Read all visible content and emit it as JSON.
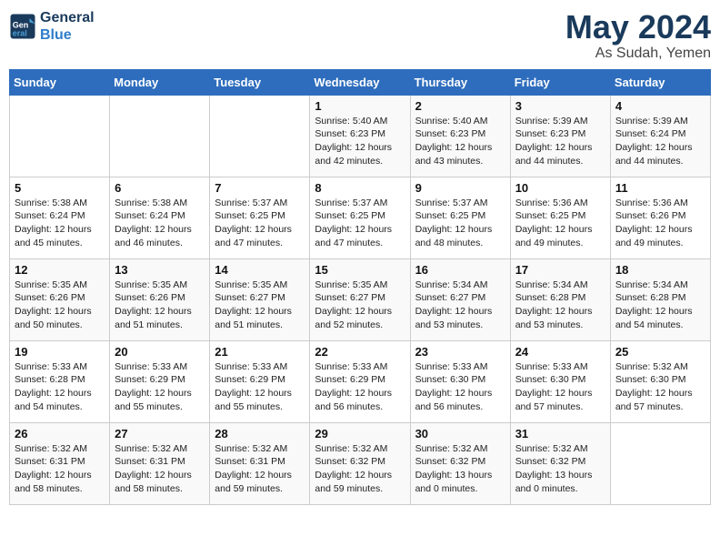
{
  "logo": {
    "line1": "General",
    "line2": "Blue"
  },
  "title": "May 2024",
  "location": "As Sudah, Yemen",
  "days_of_week": [
    "Sunday",
    "Monday",
    "Tuesday",
    "Wednesday",
    "Thursday",
    "Friday",
    "Saturday"
  ],
  "weeks": [
    [
      {
        "day": "",
        "info": ""
      },
      {
        "day": "",
        "info": ""
      },
      {
        "day": "",
        "info": ""
      },
      {
        "day": "1",
        "info": "Sunrise: 5:40 AM\nSunset: 6:23 PM\nDaylight: 12 hours\nand 42 minutes."
      },
      {
        "day": "2",
        "info": "Sunrise: 5:40 AM\nSunset: 6:23 PM\nDaylight: 12 hours\nand 43 minutes."
      },
      {
        "day": "3",
        "info": "Sunrise: 5:39 AM\nSunset: 6:23 PM\nDaylight: 12 hours\nand 44 minutes."
      },
      {
        "day": "4",
        "info": "Sunrise: 5:39 AM\nSunset: 6:24 PM\nDaylight: 12 hours\nand 44 minutes."
      }
    ],
    [
      {
        "day": "5",
        "info": "Sunrise: 5:38 AM\nSunset: 6:24 PM\nDaylight: 12 hours\nand 45 minutes."
      },
      {
        "day": "6",
        "info": "Sunrise: 5:38 AM\nSunset: 6:24 PM\nDaylight: 12 hours\nand 46 minutes."
      },
      {
        "day": "7",
        "info": "Sunrise: 5:37 AM\nSunset: 6:25 PM\nDaylight: 12 hours\nand 47 minutes."
      },
      {
        "day": "8",
        "info": "Sunrise: 5:37 AM\nSunset: 6:25 PM\nDaylight: 12 hours\nand 47 minutes."
      },
      {
        "day": "9",
        "info": "Sunrise: 5:37 AM\nSunset: 6:25 PM\nDaylight: 12 hours\nand 48 minutes."
      },
      {
        "day": "10",
        "info": "Sunrise: 5:36 AM\nSunset: 6:25 PM\nDaylight: 12 hours\nand 49 minutes."
      },
      {
        "day": "11",
        "info": "Sunrise: 5:36 AM\nSunset: 6:26 PM\nDaylight: 12 hours\nand 49 minutes."
      }
    ],
    [
      {
        "day": "12",
        "info": "Sunrise: 5:35 AM\nSunset: 6:26 PM\nDaylight: 12 hours\nand 50 minutes."
      },
      {
        "day": "13",
        "info": "Sunrise: 5:35 AM\nSunset: 6:26 PM\nDaylight: 12 hours\nand 51 minutes."
      },
      {
        "day": "14",
        "info": "Sunrise: 5:35 AM\nSunset: 6:27 PM\nDaylight: 12 hours\nand 51 minutes."
      },
      {
        "day": "15",
        "info": "Sunrise: 5:35 AM\nSunset: 6:27 PM\nDaylight: 12 hours\nand 52 minutes."
      },
      {
        "day": "16",
        "info": "Sunrise: 5:34 AM\nSunset: 6:27 PM\nDaylight: 12 hours\nand 53 minutes."
      },
      {
        "day": "17",
        "info": "Sunrise: 5:34 AM\nSunset: 6:28 PM\nDaylight: 12 hours\nand 53 minutes."
      },
      {
        "day": "18",
        "info": "Sunrise: 5:34 AM\nSunset: 6:28 PM\nDaylight: 12 hours\nand 54 minutes."
      }
    ],
    [
      {
        "day": "19",
        "info": "Sunrise: 5:33 AM\nSunset: 6:28 PM\nDaylight: 12 hours\nand 54 minutes."
      },
      {
        "day": "20",
        "info": "Sunrise: 5:33 AM\nSunset: 6:29 PM\nDaylight: 12 hours\nand 55 minutes."
      },
      {
        "day": "21",
        "info": "Sunrise: 5:33 AM\nSunset: 6:29 PM\nDaylight: 12 hours\nand 55 minutes."
      },
      {
        "day": "22",
        "info": "Sunrise: 5:33 AM\nSunset: 6:29 PM\nDaylight: 12 hours\nand 56 minutes."
      },
      {
        "day": "23",
        "info": "Sunrise: 5:33 AM\nSunset: 6:30 PM\nDaylight: 12 hours\nand 56 minutes."
      },
      {
        "day": "24",
        "info": "Sunrise: 5:33 AM\nSunset: 6:30 PM\nDaylight: 12 hours\nand 57 minutes."
      },
      {
        "day": "25",
        "info": "Sunrise: 5:32 AM\nSunset: 6:30 PM\nDaylight: 12 hours\nand 57 minutes."
      }
    ],
    [
      {
        "day": "26",
        "info": "Sunrise: 5:32 AM\nSunset: 6:31 PM\nDaylight: 12 hours\nand 58 minutes."
      },
      {
        "day": "27",
        "info": "Sunrise: 5:32 AM\nSunset: 6:31 PM\nDaylight: 12 hours\nand 58 minutes."
      },
      {
        "day": "28",
        "info": "Sunrise: 5:32 AM\nSunset: 6:31 PM\nDaylight: 12 hours\nand 59 minutes."
      },
      {
        "day": "29",
        "info": "Sunrise: 5:32 AM\nSunset: 6:32 PM\nDaylight: 12 hours\nand 59 minutes."
      },
      {
        "day": "30",
        "info": "Sunrise: 5:32 AM\nSunset: 6:32 PM\nDaylight: 13 hours\nand 0 minutes."
      },
      {
        "day": "31",
        "info": "Sunrise: 5:32 AM\nSunset: 6:32 PM\nDaylight: 13 hours\nand 0 minutes."
      },
      {
        "day": "",
        "info": ""
      }
    ]
  ]
}
